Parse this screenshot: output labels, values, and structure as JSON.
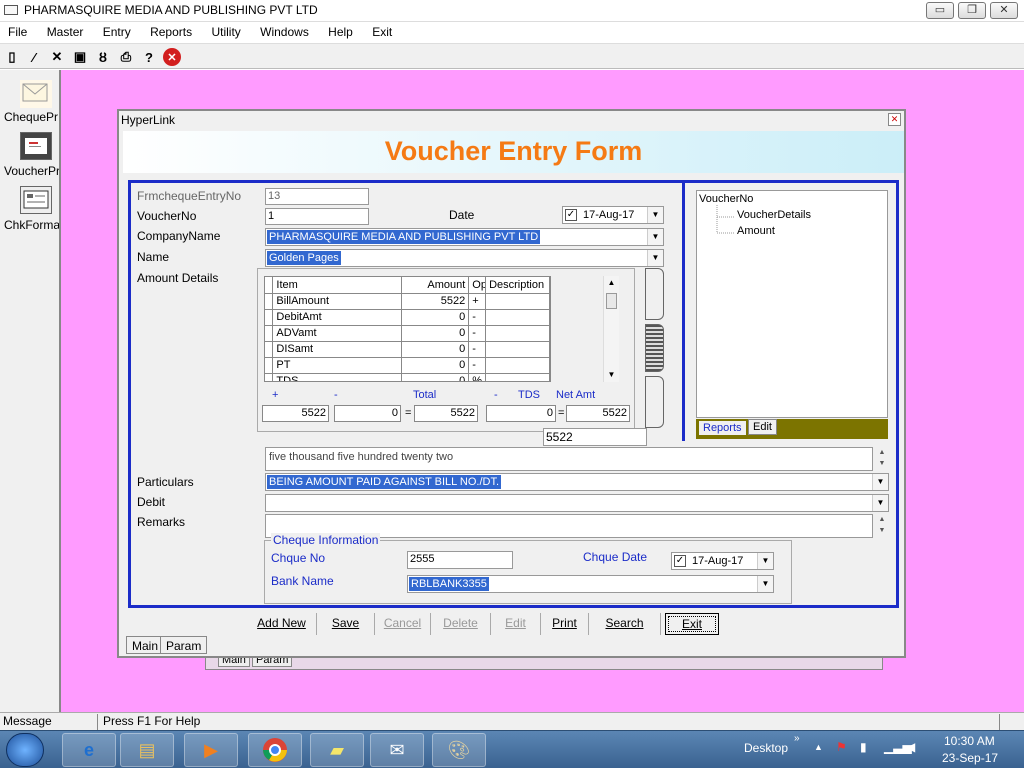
{
  "app": {
    "title": "PHARMASQUIRE MEDIA AND PUBLISHING PVT LTD",
    "window_buttons": [
      "▭",
      "❐",
      "✕"
    ]
  },
  "menu": [
    "File",
    "Master",
    "Entry",
    "Reports",
    "Utility",
    "Windows",
    "Help",
    "Exit"
  ],
  "toolbar_icons": [
    "new-file-icon",
    "magic-wand-icon",
    "delete-icon",
    "save-icon",
    "binoculars-icon",
    "print-icon",
    "help-icon",
    "close-icon"
  ],
  "left_panel": [
    {
      "label": "ChequePr",
      "icon": "envelope-icon"
    },
    {
      "label": "VoucherPr",
      "icon": "voucher-print-icon"
    },
    {
      "label": "ChkFormat",
      "icon": "cheque-format-icon"
    }
  ],
  "background_window": {
    "tabs": [
      "Main",
      "Param"
    ]
  },
  "form": {
    "window_title": "HyperLink",
    "close": "✕",
    "banner": "Voucher Entry Form",
    "fields": {
      "frm_label": "FrmchequeEntryNo",
      "frm_value": "13",
      "voucher_label": "VoucherNo",
      "voucher_value": "1",
      "date_label": "Date",
      "date_value": "17-Aug-17",
      "company_label": "CompanyName",
      "company_value": "PHARMASQUIRE MEDIA AND PUBLISHING PVT LTD",
      "name_label": "Name",
      "name_value": "Golden Pages",
      "amount_label": "Amount Details",
      "words": "five thousand five hundred twenty two",
      "particulars_label": "Particulars",
      "particulars_value": "BEING AMOUNT PAID AGAINST BILL NO./DT.",
      "debit_label": "Debit",
      "debit_value": "",
      "remarks_label": "Remarks",
      "remarks_value": ""
    },
    "grid": {
      "headers": [
        "Item",
        "Amount",
        "Op",
        "Description"
      ],
      "rows": [
        {
          "item": "BillAmount",
          "amount": "5522",
          "op": "+",
          "desc": ""
        },
        {
          "item": "DebitAmt",
          "amount": "0",
          "op": "-",
          "desc": ""
        },
        {
          "item": "ADVamt",
          "amount": "0",
          "op": "-",
          "desc": ""
        },
        {
          "item": "DISamt",
          "amount": "0",
          "op": "-",
          "desc": ""
        },
        {
          "item": "PT",
          "amount": "0",
          "op": "-",
          "desc": ""
        },
        {
          "item": "TDS",
          "amount": "0",
          "op": "%",
          "desc": ""
        }
      ],
      "sum_labels": [
        "+",
        "-",
        "Total",
        "-",
        "TDS",
        "Net Amt"
      ],
      "sum_values": [
        "5522",
        "0",
        "5522",
        "0",
        "5522"
      ],
      "sum_ops": [
        "=",
        "=",
        "="
      ],
      "net_total": "5522"
    },
    "tree": {
      "root": "VoucherNo",
      "children": [
        "VoucherDetails",
        "Amount"
      ],
      "tabs": [
        "Reports",
        "Edit"
      ]
    },
    "cheque": {
      "caption": "Cheque  Information",
      "no_label": "Chque No",
      "no_value": "2555",
      "date_label": "Chque Date",
      "date_value": "17-Aug-17",
      "bank_label": "Bank Name",
      "bank_value": "RBLBANK3355"
    },
    "buttons": [
      "Add New",
      "Save",
      "Cancel",
      "Delete",
      "Edit",
      "Print",
      "Search",
      "Exit"
    ],
    "tabs": [
      "Main",
      "Param"
    ]
  },
  "status": {
    "message": "Message",
    "help": "Press F1 For Help"
  },
  "taskbar": {
    "apps": [
      "ie-icon",
      "explorer-icon",
      "media-player-icon",
      "chrome-icon",
      "sticky-notes-icon",
      "mail-icon",
      "paint-icon"
    ],
    "desktop": "Desktop",
    "time": "10:30 AM",
    "date": "23-Sep-17"
  }
}
